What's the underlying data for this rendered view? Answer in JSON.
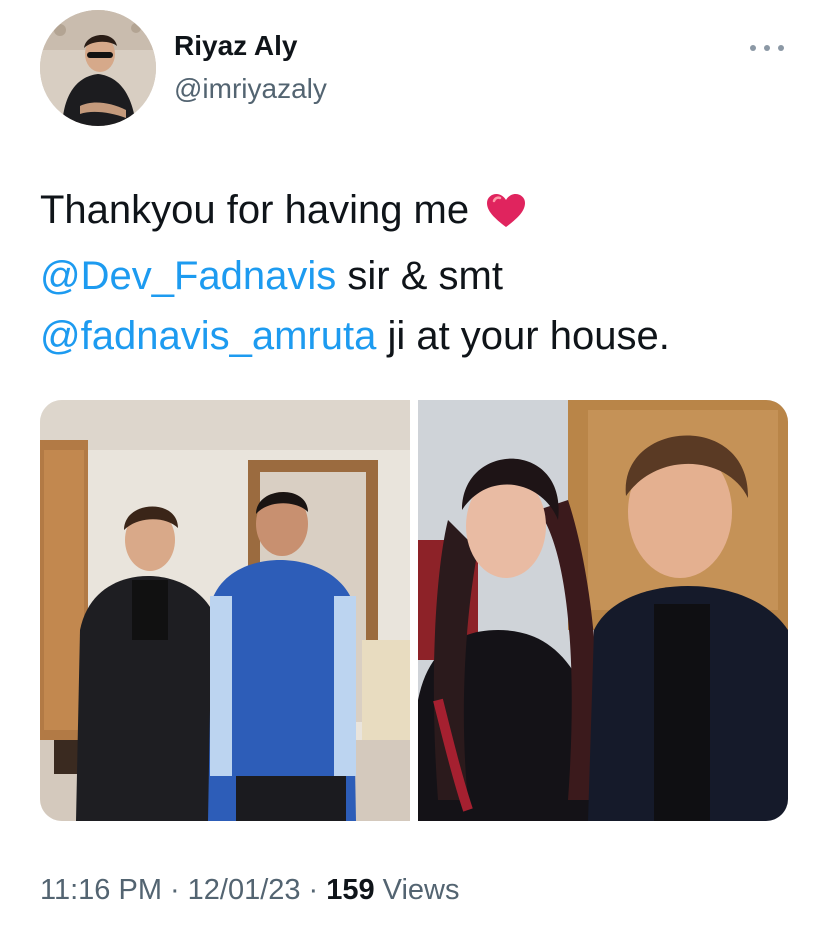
{
  "author": {
    "display_name": "Riyaz Aly",
    "handle": "@imriyazaly",
    "avatar_icon": "user-avatar"
  },
  "menu": {
    "icon": "more-horizontal-icon"
  },
  "tweet": {
    "line1_text": "Thankyou for having me",
    "line1_emoji": "red-heart-icon",
    "mention1": "@Dev_Fadnavis",
    "line2_text": " sir & smt",
    "mention2": "@fadnavis_amruta",
    "line3_text": " ji at your house."
  },
  "media": {
    "count": 2
  },
  "meta": {
    "time": "11:16 PM",
    "separator": "·",
    "date": "12/01/23",
    "views_count": "159",
    "views_label": "Views"
  },
  "colors": {
    "link": "#1d9bf0",
    "secondary_text": "#536471",
    "primary_text": "#0f1419",
    "heart": "#e0245e"
  }
}
